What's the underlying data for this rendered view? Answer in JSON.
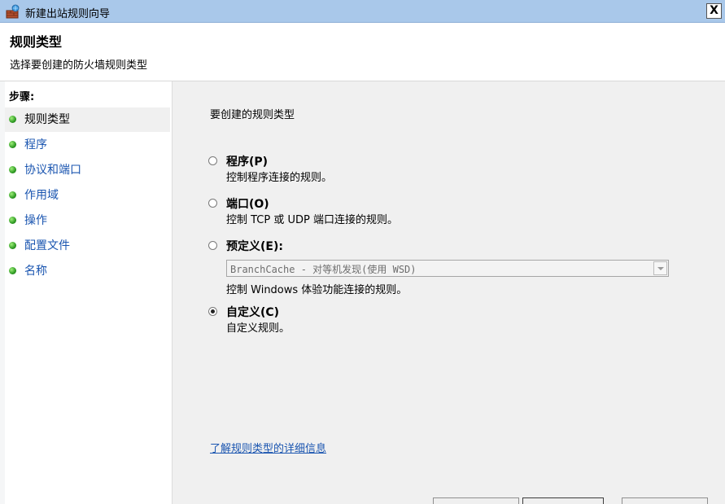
{
  "window": {
    "title": "新建出站规则向导",
    "close_label": "X"
  },
  "header": {
    "title": "规则类型",
    "subtitle": "选择要创建的防火墙规则类型"
  },
  "sidebar": {
    "heading": "步骤:",
    "steps": [
      {
        "label": "规则类型",
        "active": true
      },
      {
        "label": "程序",
        "active": false
      },
      {
        "label": "协议和端口",
        "active": false
      },
      {
        "label": "作用域",
        "active": false
      },
      {
        "label": "操作",
        "active": false
      },
      {
        "label": "配置文件",
        "active": false
      },
      {
        "label": "名称",
        "active": false
      }
    ]
  },
  "main": {
    "prompt": "要创建的规则类型",
    "options": [
      {
        "label": "程序(P)",
        "description": "控制程序连接的规则。",
        "checked": false
      },
      {
        "label": "端口(O)",
        "description": "控制 TCP 或 UDP 端口连接的规则。",
        "checked": false
      },
      {
        "label": "预定义(E):",
        "description": "控制 Windows 体验功能连接的规则。",
        "checked": false
      },
      {
        "label": "自定义(C)",
        "description": "自定义规则。",
        "checked": true
      }
    ],
    "predefined_selected": "BranchCache - 对等机发现(使用 WSD)",
    "learn_more_link": "了解规则类型的详细信息"
  },
  "colors": {
    "titlebar": "#a9c8ea",
    "link": "#1a55b0",
    "panel": "#f0f0f0"
  }
}
